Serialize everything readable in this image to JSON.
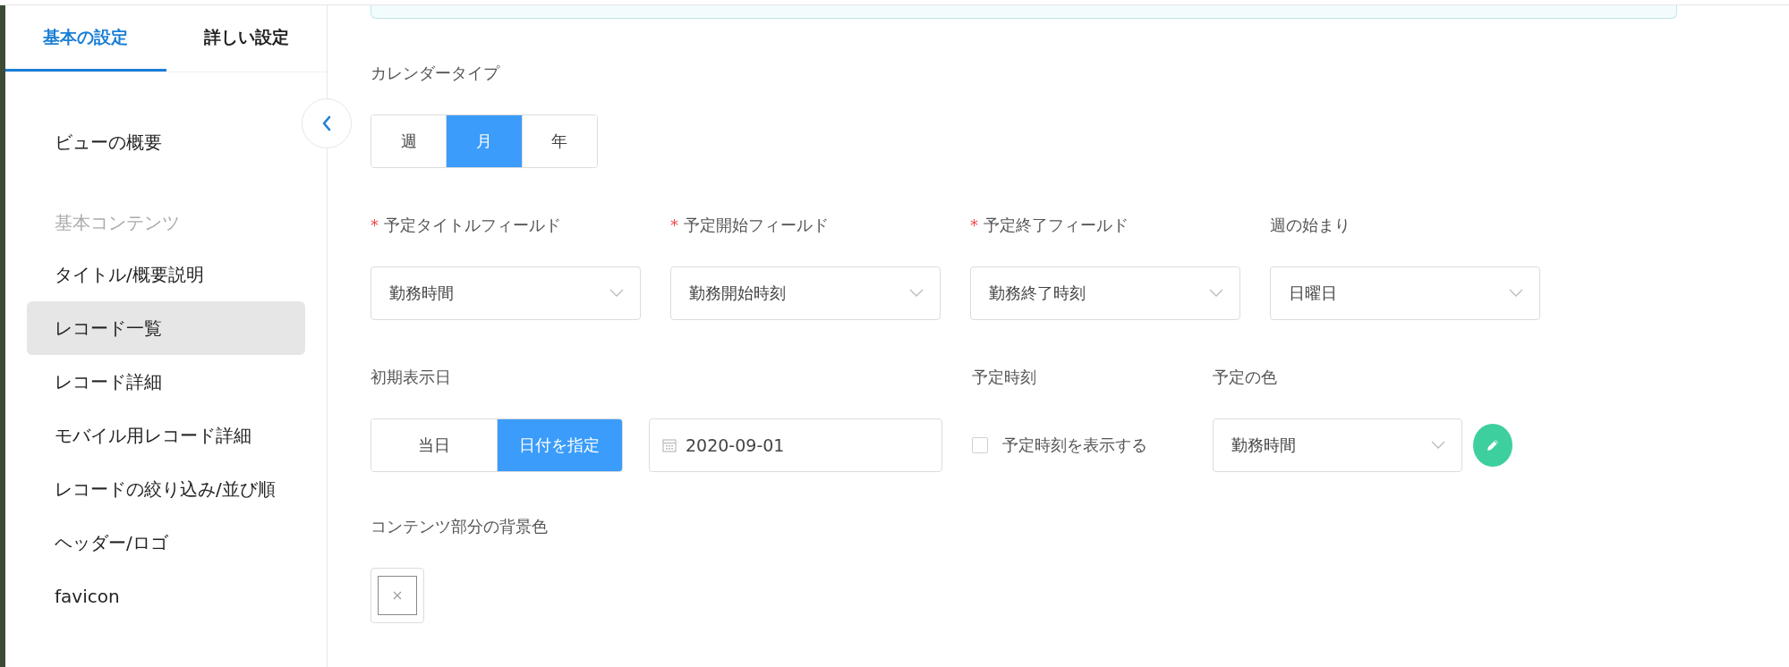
{
  "sidebar": {
    "tabs": [
      {
        "label": "基本の設定",
        "selected": true
      },
      {
        "label": "詳しい設定",
        "selected": false
      }
    ],
    "items": [
      {
        "kind": "item",
        "label": "ビューの概要",
        "selected": false
      },
      {
        "kind": "heading",
        "label": "基本コンテンツ"
      },
      {
        "kind": "item",
        "label": "タイトル/概要説明",
        "selected": false
      },
      {
        "kind": "item",
        "label": "レコード一覧",
        "selected": true
      },
      {
        "kind": "item",
        "label": "レコード詳細",
        "selected": false
      },
      {
        "kind": "item",
        "label": "モバイル用レコード詳細",
        "selected": false
      },
      {
        "kind": "item",
        "label": "レコードの絞り込み/並び順",
        "selected": false
      },
      {
        "kind": "item",
        "label": "ヘッダー/ロゴ",
        "selected": false
      },
      {
        "kind": "item",
        "label": "favicon",
        "selected": false
      }
    ]
  },
  "calendar_type": {
    "label": "カレンダータイプ",
    "options": [
      {
        "label": "週",
        "selected": false
      },
      {
        "label": "月",
        "selected": true
      },
      {
        "label": "年",
        "selected": false
      }
    ]
  },
  "fields": [
    {
      "required_mark": "*",
      "label": "予定タイトルフィールド",
      "value": "勤務時間"
    },
    {
      "required_mark": "*",
      "label": "予定開始フィールド",
      "value": "勤務開始時刻"
    },
    {
      "required_mark": "*",
      "label": "予定終了フィールド",
      "value": "勤務終了時刻"
    },
    {
      "label": "週の始まり",
      "value": "日曜日"
    }
  ],
  "initial_date": {
    "label": "初期表示日",
    "options": [
      {
        "label": "当日",
        "selected": false
      },
      {
        "label": "日付を指定",
        "selected": true
      }
    ],
    "date": "2020-09-01"
  },
  "event_time": {
    "label": "予定時刻",
    "checkbox_label": "予定時刻を表示する",
    "checked": false
  },
  "event_color": {
    "label": "予定の色",
    "value": "勤務時間"
  },
  "background_color": {
    "label": "コンテンツ部分の背景色"
  }
}
